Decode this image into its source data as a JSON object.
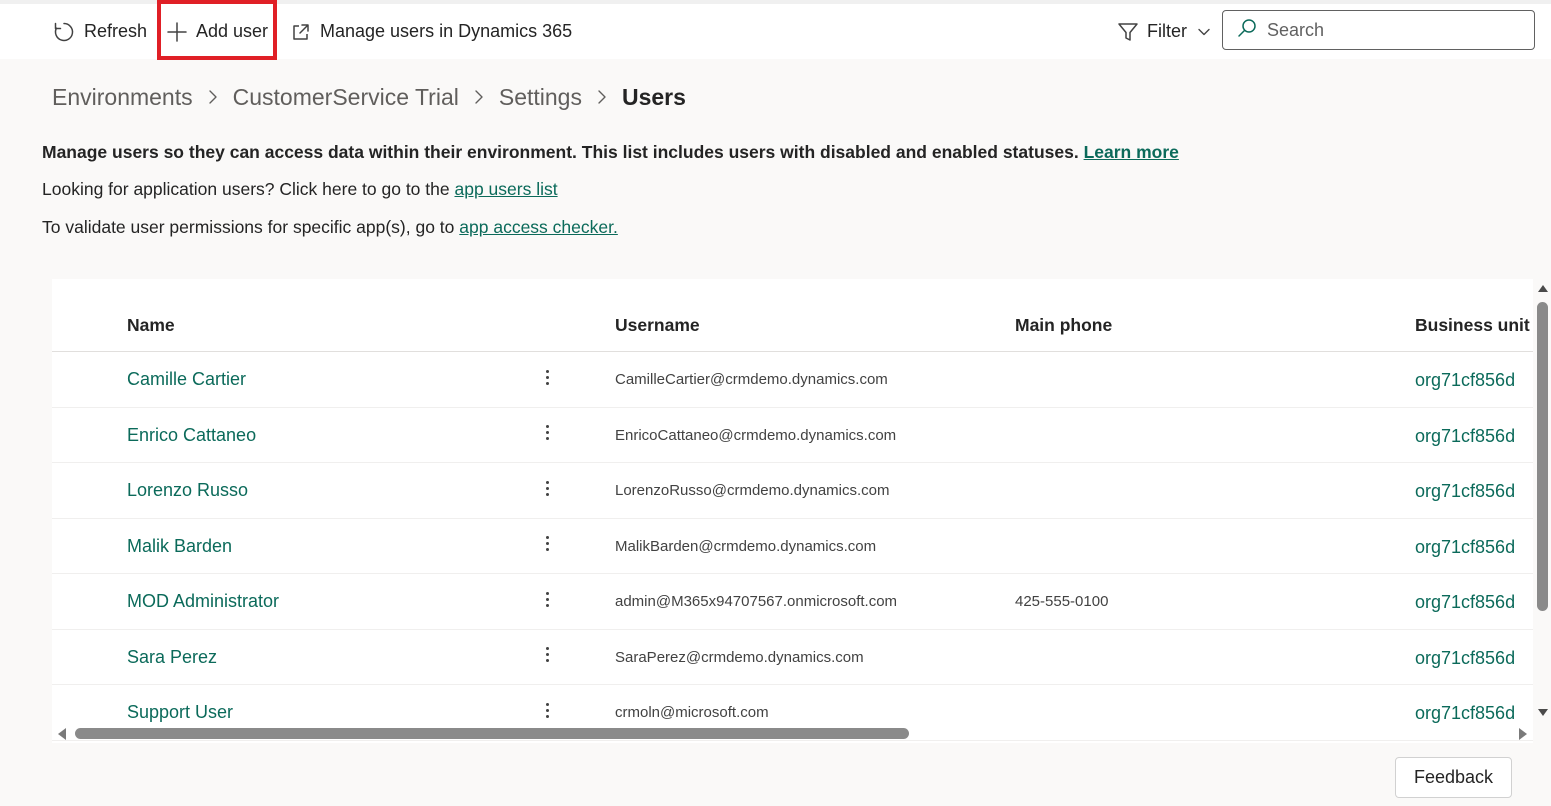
{
  "toolbar": {
    "refresh_label": "Refresh",
    "add_user_label": "Add user",
    "manage_label": "Manage users in Dynamics 365",
    "filter_label": "Filter",
    "search_placeholder": "Search",
    "highlight_color": "#e01f26"
  },
  "breadcrumb": {
    "items": [
      "Environments",
      "CustomerService Trial",
      "Settings"
    ],
    "current": "Users"
  },
  "info": {
    "line1_text": "Manage users so they can access data within their environment. This list includes users with disabled and enabled statuses.",
    "line1_link": "Learn more",
    "line2_text": "Looking for application users? Click here to go to the",
    "line2_link": "app users list",
    "line3_text": "To validate user permissions for specific app(s), go to",
    "line3_link": "app access checker."
  },
  "table": {
    "columns": [
      "Name",
      "Username",
      "Main phone",
      "Business unit"
    ],
    "rows": [
      {
        "name": "Camille Cartier",
        "username": "CamilleCartier@crmdemo.dynamics.com",
        "phone": "",
        "business_unit": "org71cf856d"
      },
      {
        "name": "Enrico Cattaneo",
        "username": "EnricoCattaneo@crmdemo.dynamics.com",
        "phone": "",
        "business_unit": "org71cf856d"
      },
      {
        "name": "Lorenzo Russo",
        "username": "LorenzoRusso@crmdemo.dynamics.com",
        "phone": "",
        "business_unit": "org71cf856d"
      },
      {
        "name": "Malik Barden",
        "username": "MalikBarden@crmdemo.dynamics.com",
        "phone": "",
        "business_unit": "org71cf856d"
      },
      {
        "name": "MOD Administrator",
        "username": "admin@M365x94707567.onmicrosoft.com",
        "phone": "425-555-0100",
        "business_unit": "org71cf856d"
      },
      {
        "name": "Sara Perez",
        "username": "SaraPerez@crmdemo.dynamics.com",
        "phone": "",
        "business_unit": "org71cf856d"
      },
      {
        "name": "Support User",
        "username": "crmoln@microsoft.com",
        "phone": "",
        "business_unit": "org71cf856d"
      }
    ]
  },
  "feedback_label": "Feedback",
  "colors": {
    "link": "#0b6a5a",
    "text": "#242424",
    "background": "#faf9f8"
  }
}
